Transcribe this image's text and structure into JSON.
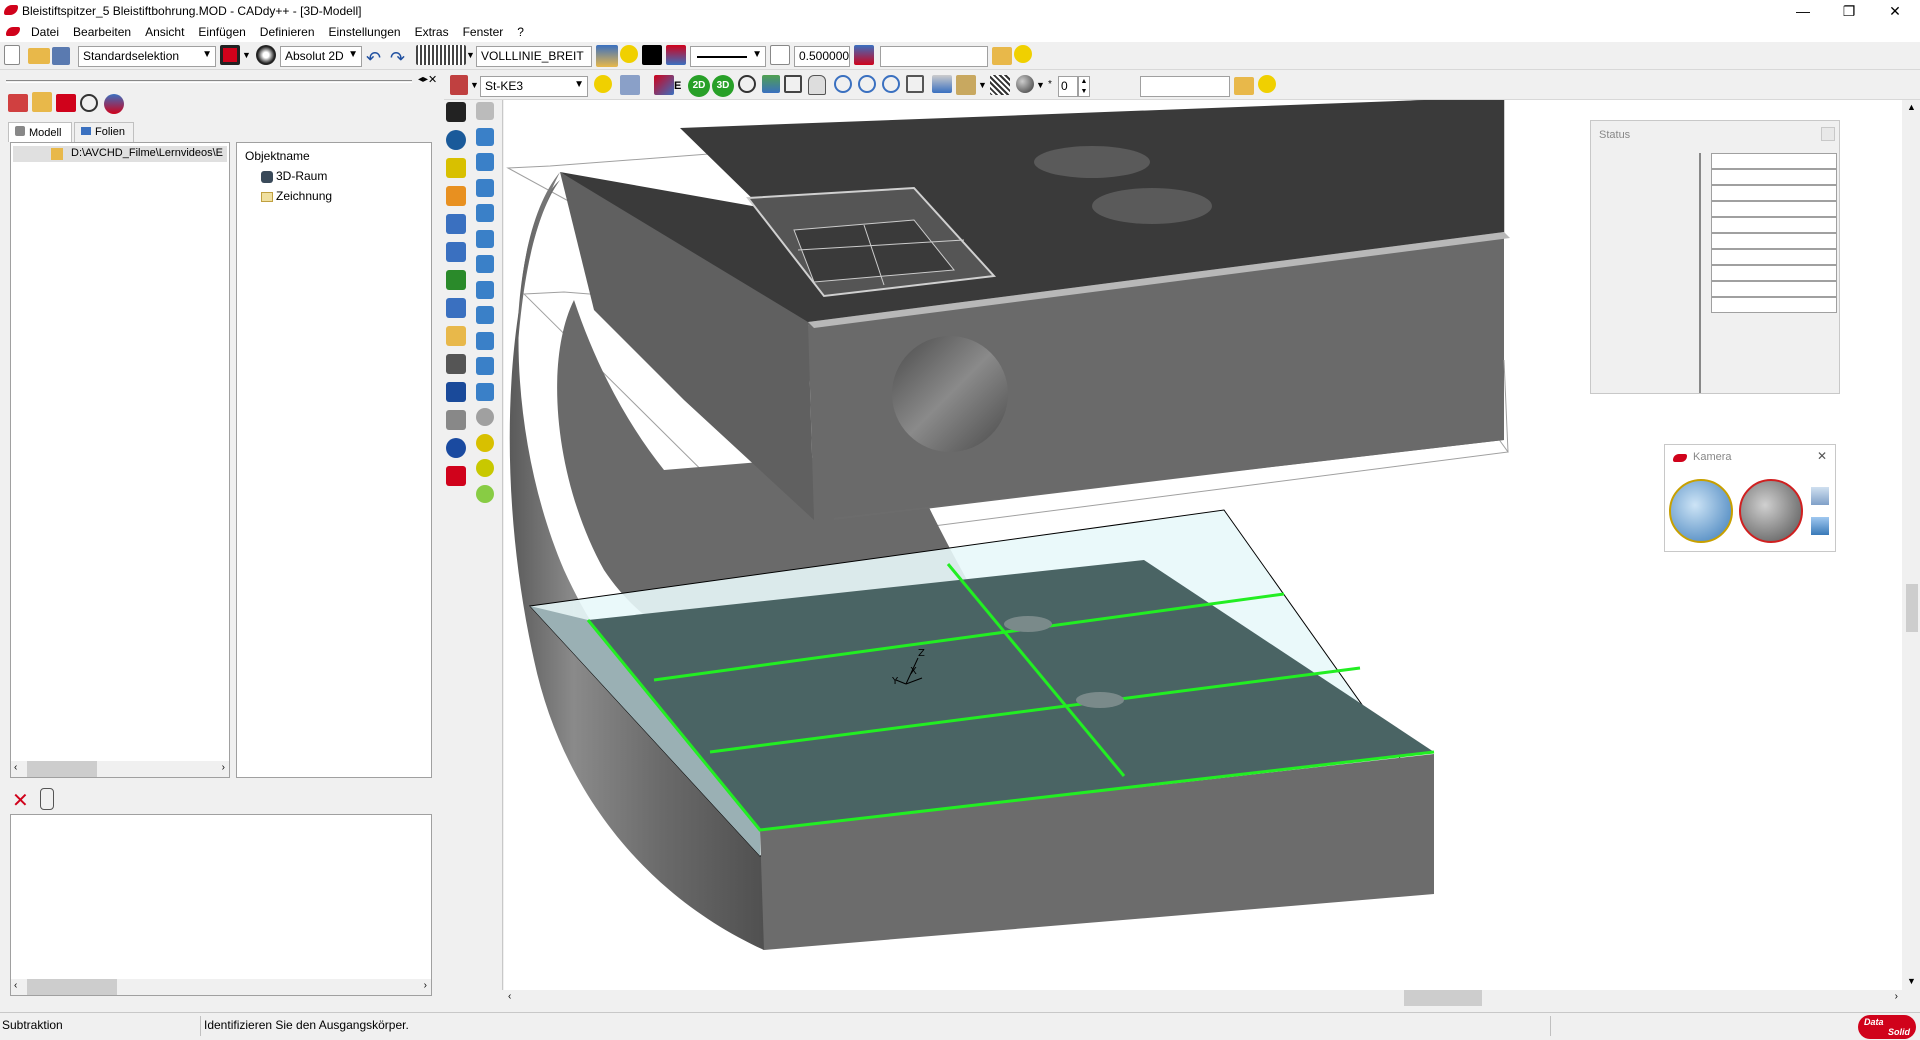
{
  "window": {
    "title": "Bleistiftspitzer_5 Bleistiftbohrung.MOD  -  CADdy++ - [3D-Modell]",
    "minimize": "—",
    "restore": "❐",
    "close": "✕"
  },
  "menu": [
    "Datei",
    "Bearbeiten",
    "Ansicht",
    "Einfügen",
    "Definieren",
    "Einstellungen",
    "Extras",
    "Fenster",
    "?"
  ],
  "toolbar1": {
    "selection_mode": "Standardselektion",
    "coord_mode": "Absolut 2D",
    "line_type": "VOLLLINIE_BREIT",
    "line_width": "0.500000",
    "extra_field": ""
  },
  "toolbar2": {
    "layer": "St-KE3",
    "counter": "0",
    "extra_field": "",
    "btn_2d": "2D",
    "btn_3d": "3D"
  },
  "left_panel": {
    "tabs": [
      "Modell",
      "Folien"
    ],
    "tree_path": "D:\\AVCHD_Filme\\Lernvideos\\E",
    "column_header": "Objektname",
    "objects": [
      "3D-Raum",
      "Zeichnung"
    ]
  },
  "status_panel": {
    "title": "Status"
  },
  "camera_panel": {
    "title": "Kamera",
    "close": "✕"
  },
  "statusbar": {
    "mode": "Subtraktion",
    "prompt": "Identifizieren Sie den Ausgangskörper.",
    "logo_top": "Data",
    "logo_bottom": "Solid"
  },
  "axis_labels": {
    "z": "Z",
    "x": "X",
    "y": "Y"
  },
  "colors": {
    "accent_red": "#d0021b",
    "edge_green": "#22ee22",
    "model_gray": "#707070"
  }
}
